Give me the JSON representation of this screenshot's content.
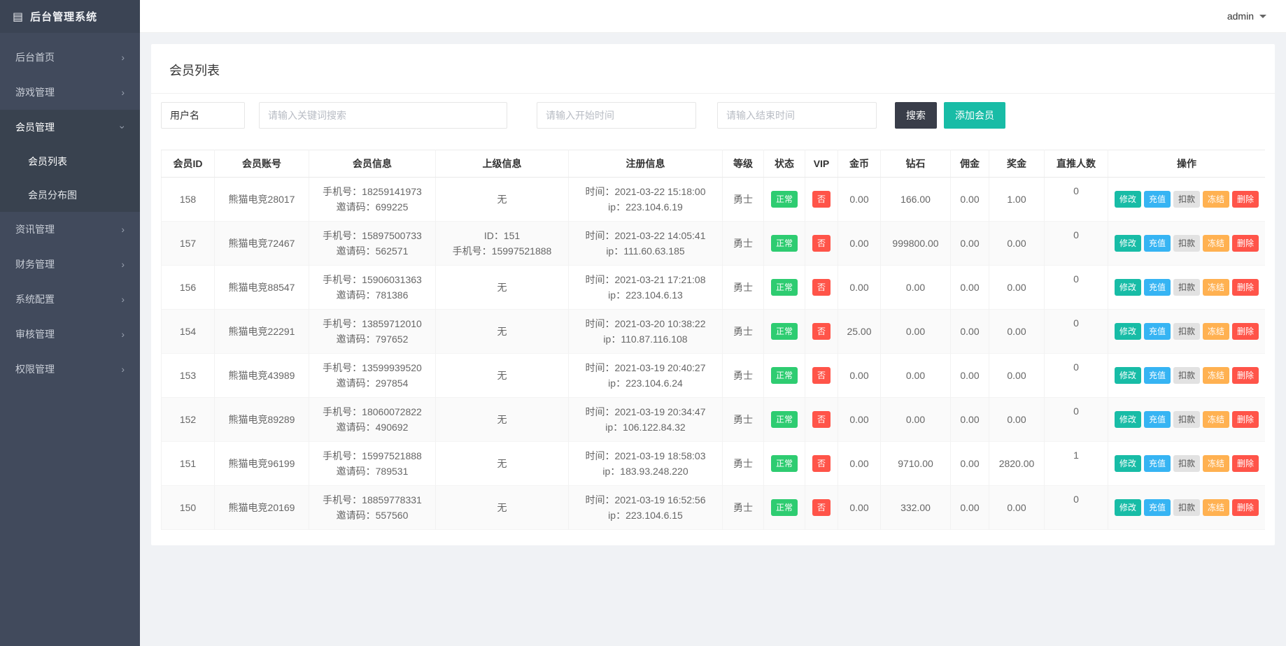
{
  "topbar": {
    "username": "admin"
  },
  "sidebar": {
    "title": "后台管理系统",
    "items": [
      {
        "label": "后台首页"
      },
      {
        "label": "游戏管理"
      },
      {
        "label": "会员管理",
        "expanded": true,
        "children": [
          "会员列表",
          "会员分布图"
        ]
      },
      {
        "label": "资讯管理"
      },
      {
        "label": "财务管理"
      },
      {
        "label": "系统配置"
      },
      {
        "label": "审核管理"
      },
      {
        "label": "权限管理"
      }
    ]
  },
  "page": {
    "title": "会员列表",
    "filters": {
      "field_select": "用户名",
      "keyword_placeholder": "请输入关键词搜索",
      "start_placeholder": "请输入开始时间",
      "end_placeholder": "请输入结束时间",
      "search_label": "搜索",
      "add_label": "添加会员"
    },
    "table": {
      "headers": [
        "会员ID",
        "会员账号",
        "会员信息",
        "上级信息",
        "注册信息",
        "等级",
        "状态",
        "VIP",
        "金币",
        "钻石",
        "佣金",
        "奖金",
        "直推人数",
        "操作"
      ],
      "action_labels": [
        "修改",
        "充值",
        "扣款",
        "冻结",
        "删除"
      ],
      "rows": [
        {
          "id": "158",
          "account": "熊猫电竞28017",
          "info": [
            "手机号：18259141973",
            "邀请码：699225"
          ],
          "parent": [
            "无"
          ],
          "register": [
            "时间：2021-03-22 15:18:00",
            "ip：223.104.6.19"
          ],
          "level": "勇士",
          "status": "正常",
          "vip": "否",
          "gold": "0.00",
          "diamond": "166.00",
          "commission": "0.00",
          "bonus": "1.00",
          "referrals": "0"
        },
        {
          "id": "157",
          "account": "熊猫电竞72467",
          "info": [
            "手机号：15897500733",
            "邀请码：562571"
          ],
          "parent": [
            "ID：151",
            "手机号：15997521888"
          ],
          "register": [
            "时间：2021-03-22 14:05:41",
            "ip：111.60.63.185"
          ],
          "level": "勇士",
          "status": "正常",
          "vip": "否",
          "gold": "0.00",
          "diamond": "999800.00",
          "commission": "0.00",
          "bonus": "0.00",
          "referrals": "0"
        },
        {
          "id": "156",
          "account": "熊猫电竞88547",
          "info": [
            "手机号：15906031363",
            "邀请码：781386"
          ],
          "parent": [
            "无"
          ],
          "register": [
            "时间：2021-03-21 17:21:08",
            "ip：223.104.6.13"
          ],
          "level": "勇士",
          "status": "正常",
          "vip": "否",
          "gold": "0.00",
          "diamond": "0.00",
          "commission": "0.00",
          "bonus": "0.00",
          "referrals": "0"
        },
        {
          "id": "154",
          "account": "熊猫电竞22291",
          "info": [
            "手机号：13859712010",
            "邀请码：797652"
          ],
          "parent": [
            "无"
          ],
          "register": [
            "时间：2021-03-20 10:38:22",
            "ip：110.87.116.108"
          ],
          "level": "勇士",
          "status": "正常",
          "vip": "否",
          "gold": "25.00",
          "diamond": "0.00",
          "commission": "0.00",
          "bonus": "0.00",
          "referrals": "0"
        },
        {
          "id": "153",
          "account": "熊猫电竞43989",
          "info": [
            "手机号：13599939520",
            "邀请码：297854"
          ],
          "parent": [
            "无"
          ],
          "register": [
            "时间：2021-03-19 20:40:27",
            "ip：223.104.6.24"
          ],
          "level": "勇士",
          "status": "正常",
          "vip": "否",
          "gold": "0.00",
          "diamond": "0.00",
          "commission": "0.00",
          "bonus": "0.00",
          "referrals": "0"
        },
        {
          "id": "152",
          "account": "熊猫电竞89289",
          "info": [
            "手机号：18060072822",
            "邀请码：490692"
          ],
          "parent": [
            "无"
          ],
          "register": [
            "时间：2021-03-19 20:34:47",
            "ip：106.122.84.32"
          ],
          "level": "勇士",
          "status": "正常",
          "vip": "否",
          "gold": "0.00",
          "diamond": "0.00",
          "commission": "0.00",
          "bonus": "0.00",
          "referrals": "0"
        },
        {
          "id": "151",
          "account": "熊猫电竞96199",
          "info": [
            "手机号：15997521888",
            "邀请码：789531"
          ],
          "parent": [
            "无"
          ],
          "register": [
            "时间：2021-03-19 18:58:03",
            "ip：183.93.248.220"
          ],
          "level": "勇士",
          "status": "正常",
          "vip": "否",
          "gold": "0.00",
          "diamond": "9710.00",
          "commission": "0.00",
          "bonus": "2820.00",
          "referrals": "1"
        },
        {
          "id": "150",
          "account": "熊猫电竞20169",
          "info": [
            "手机号：18859778331",
            "邀请码：557560"
          ],
          "parent": [
            "无"
          ],
          "register": [
            "时间：2021-03-19 16:52:56",
            "ip：223.104.6.15"
          ],
          "level": "勇士",
          "status": "正常",
          "vip": "否",
          "gold": "0.00",
          "diamond": "332.00",
          "commission": "0.00",
          "bonus": "0.00",
          "referrals": "0"
        }
      ]
    }
  },
  "colors": {
    "sidebar_bg": "#414a5c",
    "sidebar_group_bg": "#39424f",
    "primary_teal": "#18bca6",
    "info_blue": "#36b4f3",
    "warning_orange": "#ffb151",
    "danger_red": "#ff5449",
    "success_green": "#2ecc71",
    "dark_button": "#393d49"
  }
}
